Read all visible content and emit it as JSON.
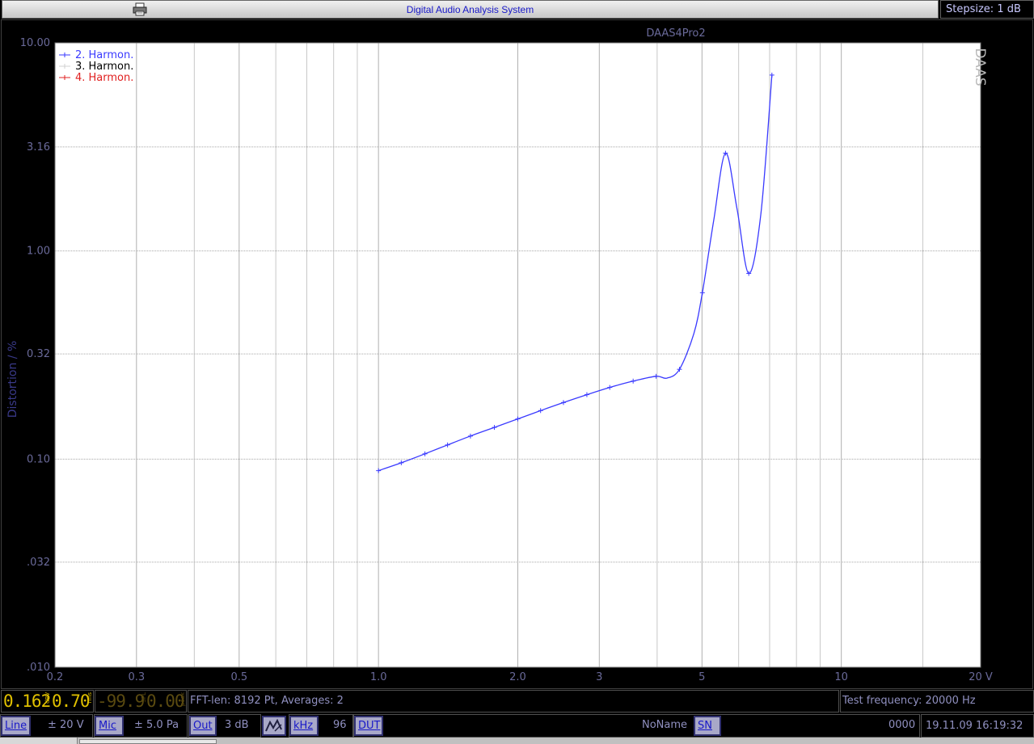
{
  "window": {
    "title": "Digital Audio Analysis System",
    "stepsize": "Stepsize: 1 dB"
  },
  "chart_data": {
    "type": "line",
    "title": "DAAS4Pro2",
    "watermark": "DAAS",
    "xlabel": "",
    "ylabel": "Distortion / %",
    "x_unit": "V",
    "x_scale": "log",
    "y_scale": "log",
    "xlim": [
      0.2,
      20
    ],
    "ylim": [
      0.01,
      10
    ],
    "grid": true,
    "legend_position": "top-left",
    "x_ticks": [
      {
        "v": 0.2,
        "label": "0.2"
      },
      {
        "v": 0.3,
        "label": "0.3"
      },
      {
        "v": 0.5,
        "label": "0.5"
      },
      {
        "v": 1.0,
        "label": "1.0"
      },
      {
        "v": 2.0,
        "label": "2.0"
      },
      {
        "v": 3,
        "label": "3"
      },
      {
        "v": 5,
        "label": "5"
      },
      {
        "v": 10,
        "label": "10"
      },
      {
        "v": 20,
        "label": "20 V"
      }
    ],
    "x_minor": [
      0.4,
      0.6,
      0.7,
      0.8,
      0.9,
      4,
      6,
      7,
      8,
      9,
      15
    ],
    "y_ticks": [
      {
        "v": 10,
        "label": "10.00"
      },
      {
        "v": 3.16,
        "label": "3.16"
      },
      {
        "v": 1.0,
        "label": "1.00"
      },
      {
        "v": 0.32,
        "label": "0.32"
      },
      {
        "v": 0.1,
        "label": "0.10"
      },
      {
        "v": 0.032,
        "label": ".032"
      },
      {
        "v": 0.01,
        "label": ".010"
      }
    ],
    "series": [
      {
        "name": "2. Harmon.",
        "color": "#3a3aff",
        "x": [
          1.0,
          1.12,
          1.26,
          1.41,
          1.58,
          1.78,
          2.0,
          2.24,
          2.51,
          2.82,
          3.16,
          3.55,
          3.98,
          4.2,
          4.47,
          4.8,
          5.01,
          5.3,
          5.62,
          5.95,
          6.31,
          6.7,
          7.08
        ],
        "y": [
          0.088,
          0.096,
          0.106,
          0.117,
          0.129,
          0.142,
          0.156,
          0.171,
          0.187,
          0.204,
          0.221,
          0.237,
          0.25,
          0.245,
          0.27,
          0.4,
          0.63,
          1.4,
          2.95,
          1.6,
          0.78,
          1.5,
          7.0
        ],
        "markers": [
          1.0,
          1.12,
          1.26,
          1.41,
          1.58,
          1.78,
          2.0,
          2.24,
          2.51,
          2.82,
          3.16,
          3.55,
          3.98,
          4.47,
          5.01,
          5.62,
          6.31,
          7.08
        ]
      },
      {
        "name": "3. Harmon.",
        "color": "#d0d0d0",
        "x": [],
        "y": []
      },
      {
        "name": "4. Harmon.",
        "color": "#e02020",
        "x": [],
        "y": []
      }
    ]
  },
  "status": {
    "lcd1_value": "0.162",
    "lcd1_unit": "dBV",
    "lcd2_value": "0.70",
    "lcd2_unit": "rms",
    "lcd3_value": "-99.9",
    "lcd3_unit": "SPL",
    "lcd4_value": "0.00",
    "lcd4_unit": "peak",
    "fft_info": "FFT-len: 8192 Pt, Averages: 2",
    "test_frequency": "Test frequency: 20000 Hz"
  },
  "controls": {
    "line_label": "Line",
    "line_range": "± 20 V",
    "mic_label": "Mic",
    "mic_range": "± 5.0 Pa",
    "out_label": "Out",
    "out_value": "3 dB",
    "khz_label": "kHz",
    "khz_value": "96",
    "dut_label": "DUT",
    "name_value": "NoName",
    "sn_label": "SN",
    "sn_value": "0000",
    "datetime": "19.11.09 16:19:32"
  }
}
